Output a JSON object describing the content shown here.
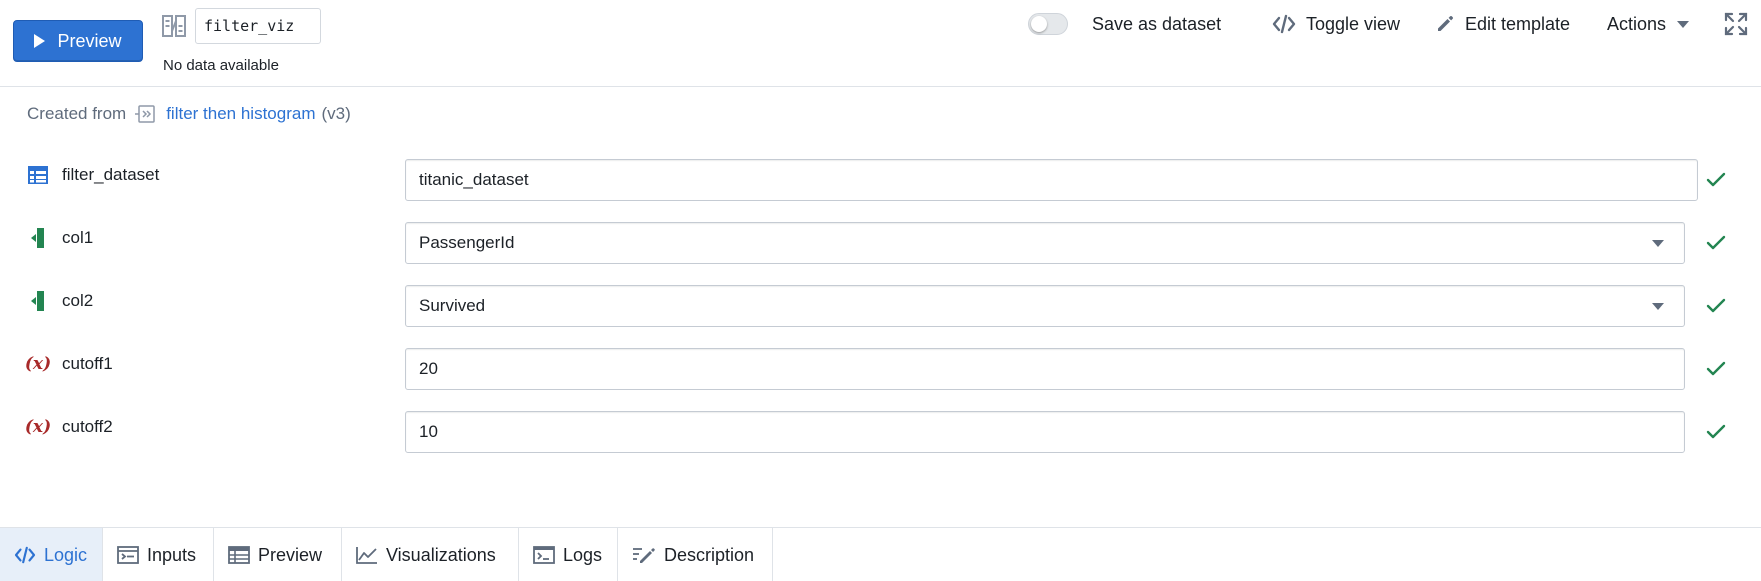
{
  "toolbar": {
    "preview_label": "Preview",
    "node_name": "filter_viz",
    "status_text": "No data available",
    "save_as_dataset_label": "Save as dataset",
    "save_as_dataset_on": false,
    "toggle_view_label": "Toggle view",
    "edit_template_label": "Edit template",
    "actions_label": "Actions"
  },
  "created_from": {
    "prefix": "Created from",
    "template_name": "filter then histogram",
    "version": "(v3)"
  },
  "params": [
    {
      "label": "filter_dataset",
      "icon": "dataset-table-icon",
      "value": "titanic_dataset",
      "type": "dataset",
      "valid": true
    },
    {
      "label": "col1",
      "icon": "column-icon",
      "value": "PassengerId",
      "type": "select",
      "valid": true
    },
    {
      "label": "col2",
      "icon": "column-icon",
      "value": "Survived",
      "type": "select",
      "valid": true
    },
    {
      "label": "cutoff1",
      "icon": "variable-icon",
      "icon_glyph": "(x)",
      "value": "20",
      "type": "number",
      "valid": true
    },
    {
      "label": "cutoff2",
      "icon": "variable-icon",
      "icon_glyph": "(x)",
      "value": "10",
      "type": "number",
      "valid": true
    }
  ],
  "tabs": [
    {
      "label": "Logic",
      "icon": "code-icon",
      "active": true
    },
    {
      "label": "Inputs",
      "icon": "inputs-icon",
      "active": false
    },
    {
      "label": "Preview",
      "icon": "table-icon",
      "active": false
    },
    {
      "label": "Visualizations",
      "icon": "line-chart-icon",
      "active": false
    },
    {
      "label": "Logs",
      "icon": "console-icon",
      "active": false
    },
    {
      "label": "Description",
      "icon": "edit-description-icon",
      "active": false
    }
  ],
  "colors": {
    "primary": "#2d72d2",
    "success": "#238551",
    "variable": "#a82a2a",
    "column": "#238551"
  }
}
